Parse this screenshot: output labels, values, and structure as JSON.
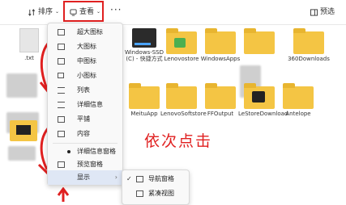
{
  "toolbar": {
    "sort_label": "排序",
    "view_label": "查看",
    "more_label": "···",
    "preview_label": "预选"
  },
  "files": [
    {
      "label": ".txt"
    },
    {
      "label": "Windows-SSD (C) - 快捷方式"
    },
    {
      "label": "Lenovostore"
    },
    {
      "label": "WindowsApps"
    },
    {
      "label": "360Downloads"
    },
    {
      "label": "MeituApp"
    },
    {
      "label": "LenovoSoftstore"
    },
    {
      "label": "FFOutput"
    },
    {
      "label": "LeStoreDownload"
    },
    {
      "label": "Antelope"
    }
  ],
  "view_menu": {
    "items": [
      {
        "label": "超大图标"
      },
      {
        "label": "大图标"
      },
      {
        "label": "中图标"
      },
      {
        "label": "小图标"
      },
      {
        "label": "列表"
      },
      {
        "label": "详细信息"
      },
      {
        "label": "平铺"
      },
      {
        "label": "内容"
      },
      {
        "label": "详细信息窗格"
      },
      {
        "label": "预览窗格"
      },
      {
        "label": "显示"
      }
    ]
  },
  "show_submenu": {
    "items": [
      {
        "label": "导航窗格"
      },
      {
        "label": "紧凑视图"
      }
    ]
  },
  "annotation": {
    "text": "依次点击"
  },
  "colors": {
    "highlight": "#e02020",
    "folder": "#f4c544",
    "accent": "#2b6cd6"
  }
}
